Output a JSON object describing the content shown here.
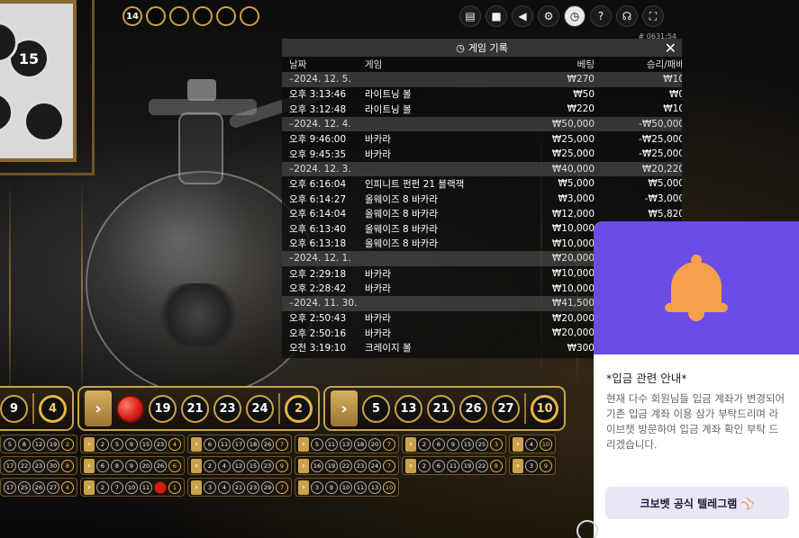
{
  "recent_results": {
    "count_label": "14"
  },
  "toolbar": {
    "icons": [
      "chat-icon",
      "video-icon",
      "sound-icon",
      "settings-icon",
      "history-icon",
      "help-icon",
      "headset-icon",
      "fullscreen-icon"
    ]
  },
  "session_id": "# 0631:54",
  "history": {
    "title": "게임 기록",
    "columns": {
      "date": "날짜",
      "game": "게임",
      "bet": "베팅",
      "result": "승리/패배"
    },
    "rows": [
      {
        "type": "date",
        "time": "–2024. 12. 5.",
        "game": "",
        "bet": "₩270",
        "result": "₩10"
      },
      {
        "type": "entry",
        "time": "오후 3:13:46",
        "game": "라이트닝 볼",
        "bet": "₩50",
        "result": "₩0"
      },
      {
        "type": "entry",
        "time": "오후 3:12:48",
        "game": "라이트닝 볼",
        "bet": "₩220",
        "result": "₩10"
      },
      {
        "type": "date",
        "time": "–2024. 12. 4.",
        "game": "",
        "bet": "₩50,000",
        "result": "-₩50,000"
      },
      {
        "type": "entry",
        "time": "오후 9:46:00",
        "game": "바카라",
        "bet": "₩25,000",
        "result": "-₩25,000"
      },
      {
        "type": "entry",
        "time": "오후 9:45:35",
        "game": "바카라",
        "bet": "₩25,000",
        "result": "-₩25,000"
      },
      {
        "type": "date",
        "time": "–2024. 12. 3.",
        "game": "",
        "bet": "₩40,000",
        "result": "₩20,220"
      },
      {
        "type": "entry",
        "time": "오후 6:16:04",
        "game": "인피니트 펀펀 21 블랙잭",
        "bet": "₩5,000",
        "result": "₩5,000"
      },
      {
        "type": "entry",
        "time": "오후 6:14:27",
        "game": "올웨이즈 8 바카라",
        "bet": "₩3,000",
        "result": "-₩3,000"
      },
      {
        "type": "entry",
        "time": "오후 6:14:04",
        "game": "올웨이즈 8 바카라",
        "bet": "₩12,000",
        "result": "₩5,820"
      },
      {
        "type": "entry",
        "time": "오후 6:13:40",
        "game": "올웨이즈 8 바카라",
        "bet": "₩10,000",
        "result": ""
      },
      {
        "type": "entry",
        "time": "오후 6:13:18",
        "game": "올웨이즈 8 바카라",
        "bet": "₩10,000",
        "result": ""
      },
      {
        "type": "date",
        "time": "–2024. 12. 1.",
        "game": "",
        "bet": "₩20,000",
        "result": ""
      },
      {
        "type": "entry",
        "time": "오후 2:29:18",
        "game": "바카라",
        "bet": "₩10,000",
        "result": ""
      },
      {
        "type": "entry",
        "time": "오후 2:28:42",
        "game": "바카라",
        "bet": "₩10,000",
        "result": ""
      },
      {
        "type": "date",
        "time": "–2024. 11. 30.",
        "game": "",
        "bet": "₩41,500",
        "result": ""
      },
      {
        "type": "entry",
        "time": "오후 2:50:43",
        "game": "바카라",
        "bet": "₩20,000",
        "result": ""
      },
      {
        "type": "entry",
        "time": "오후 2:50:16",
        "game": "바카라",
        "bet": "₩20,000",
        "result": ""
      },
      {
        "type": "entry",
        "time": "오전 3:19:10",
        "game": "크레이지 볼",
        "bet": "₩300",
        "result": ""
      }
    ]
  },
  "big_road": [
    {
      "balls": [
        "9",
        "4"
      ],
      "gold": [
        1
      ],
      "arrow": false
    },
    {
      "balls": [
        "",
        "19",
        "21",
        "23",
        "24",
        "2"
      ],
      "gold": [
        5
      ],
      "red": [
        0
      ],
      "arrow": true
    },
    {
      "balls": [
        "5",
        "13",
        "21",
        "26",
        "27",
        "10"
      ],
      "gold": [
        5
      ],
      "arrow": true
    }
  ],
  "mini_road": [
    [
      [
        "5",
        "8",
        "12",
        "19",
        "2"
      ],
      [
        "2",
        "5",
        "9",
        "15",
        "23",
        "4"
      ],
      [
        "6",
        "11",
        "17",
        "18",
        "26",
        "7"
      ],
      [
        "5",
        "11",
        "13",
        "18",
        "20",
        "7"
      ],
      [
        "2",
        "6",
        "9",
        "15",
        "25",
        "3"
      ],
      [
        "4",
        "10"
      ]
    ],
    [
      [
        "17",
        "22",
        "23",
        "30",
        "8"
      ],
      [
        "6",
        "8",
        "9",
        "20",
        "26",
        "6"
      ],
      [
        "2",
        "4",
        "12",
        "15",
        "23",
        "9"
      ],
      [
        "16",
        "19",
        "22",
        "23",
        "24",
        "7"
      ],
      [
        "2",
        "6",
        "11",
        "19",
        "22",
        "8"
      ],
      [
        "3",
        "9"
      ]
    ],
    [
      [
        "17",
        "25",
        "26",
        "27",
        "4"
      ],
      [
        "2",
        "7",
        "10",
        "11",
        "",
        "1"
      ],
      [
        "3",
        "4",
        "21",
        "23",
        "29",
        "7"
      ],
      [
        "3",
        "9",
        "10",
        "11",
        "13",
        "10"
      ]
    ]
  ],
  "notice": {
    "title": "*입금 관련 안내*",
    "text": "현재 다수 회원님들 입금 계좌가 변경되어 기존 입금 계좌 이용 삼가 부탁드리며 라이브챗 방문하여 입금 계좌 확인 부탁 드리겠습니다.",
    "button": "크보벳 공식 텔레그램 ⚾"
  },
  "colors": {
    "gold": "#c9a24b",
    "notice_header": "#6b4ce6",
    "bell": "#f5a04a"
  }
}
